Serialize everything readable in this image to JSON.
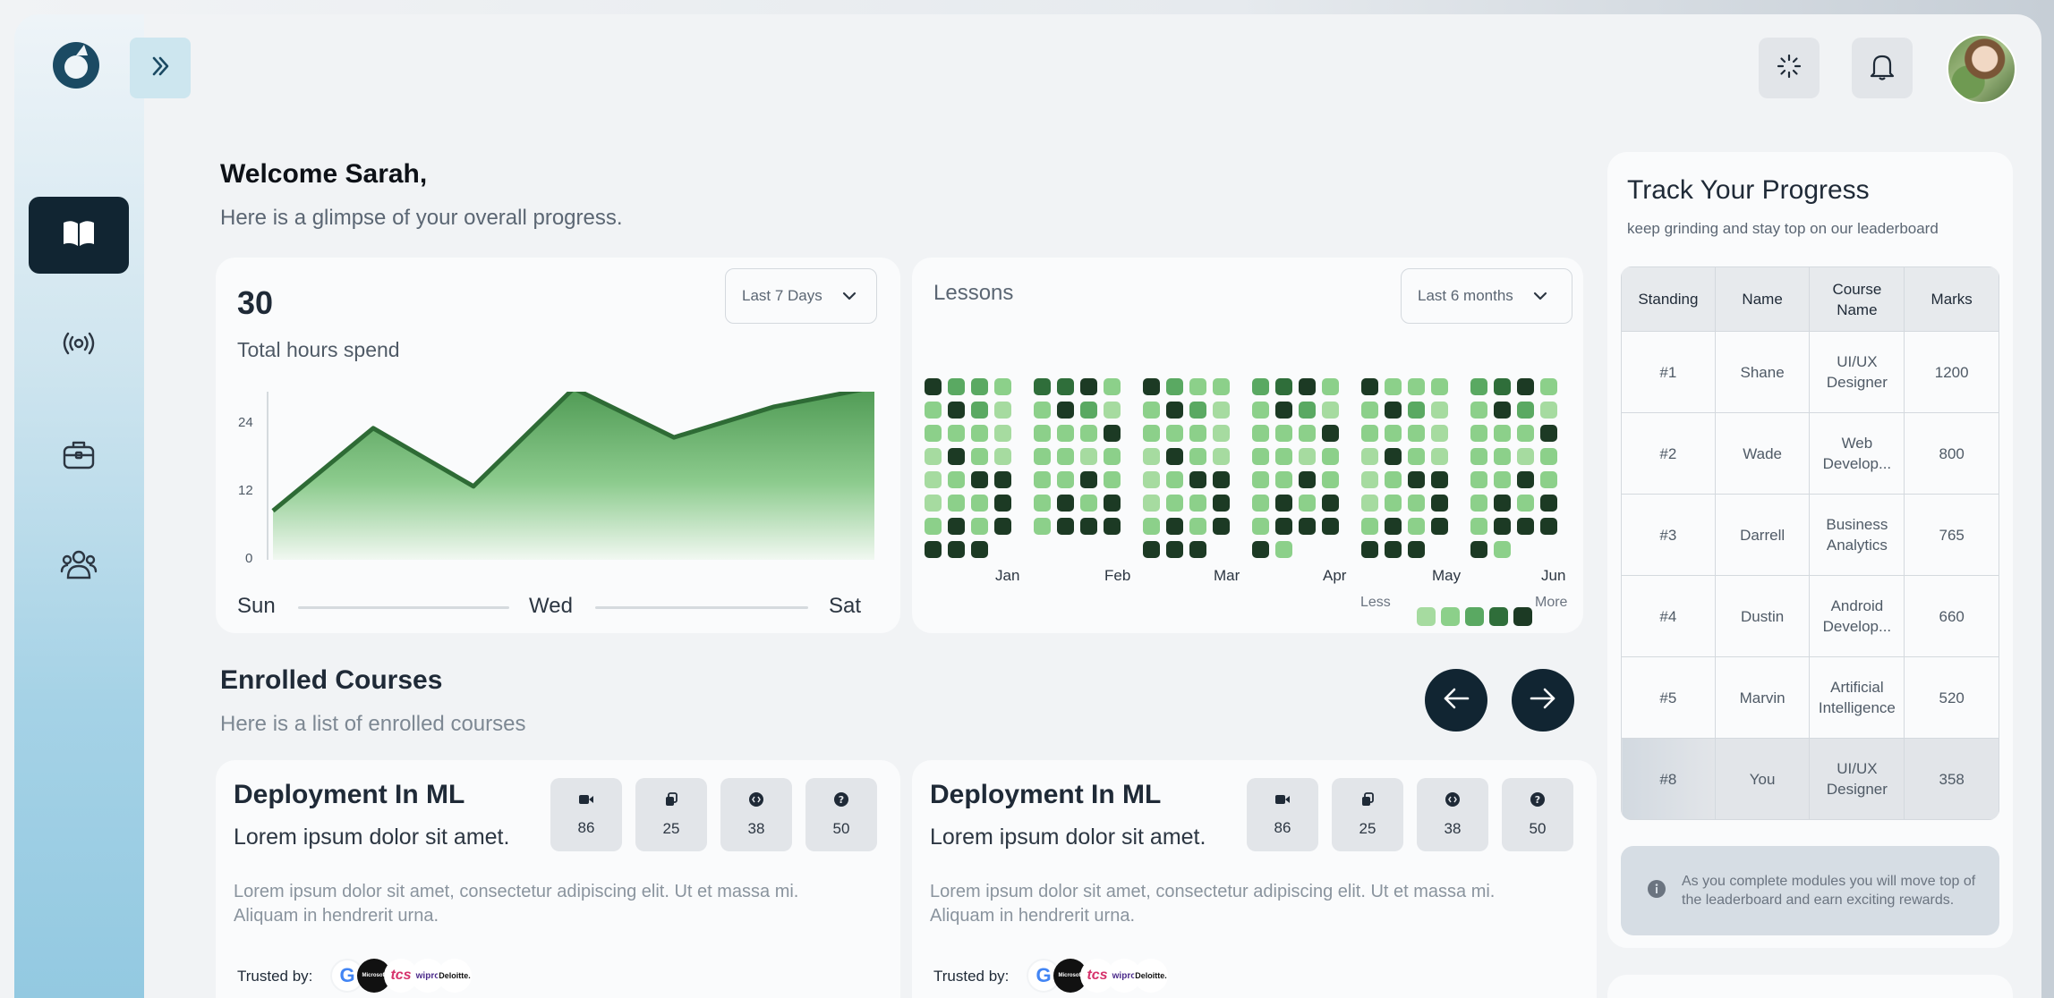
{
  "header": {
    "welcome": "Welcome Sarah,",
    "subtitle": "Here is a glimpse of your overall progress."
  },
  "sidebar": {
    "items": [
      {
        "icon": "book-icon",
        "active": true
      },
      {
        "icon": "broadcast-icon",
        "active": false
      },
      {
        "icon": "briefcase-icon",
        "active": false
      },
      {
        "icon": "users-icon",
        "active": false
      }
    ]
  },
  "hours_card": {
    "value": "30",
    "label": "Total hours spend",
    "range": "Last 7 Days",
    "y_ticks": [
      "24",
      "12",
      "0"
    ],
    "x_labels": [
      "Sun",
      "Wed",
      "Sat"
    ]
  },
  "chart_data": {
    "type": "area",
    "title": "",
    "xlabel": "",
    "ylabel": "",
    "x": [
      0,
      1,
      2,
      3,
      4,
      5,
      6
    ],
    "xlim": [
      0,
      6
    ],
    "ylim": [
      0,
      26
    ],
    "series": [
      {
        "values": [
          8,
          21.5,
          12,
          28,
          20,
          25,
          28.2
        ]
      }
    ],
    "x_tick_labels": [
      "Sun",
      "Wed",
      "Sat"
    ],
    "y_tick_labels": [
      "24",
      "12",
      "0"
    ],
    "color": "#2e6b35"
  },
  "lessons": {
    "title": "Lessons",
    "range": "Last 6 months",
    "months": [
      "Jan",
      "Feb",
      "Mar",
      "Apr",
      "May",
      "Jun"
    ],
    "legend_less": "Less",
    "legend_more": "More",
    "levels": [
      "#a6dba0",
      "#8cd08a",
      "#5aa962",
      "#2f6e3a",
      "#1c3a24"
    ],
    "grid": [
      [
        4,
        2,
        2,
        1,
        3,
        3,
        4,
        1,
        4,
        2,
        1,
        1,
        2,
        3,
        4,
        1,
        4,
        1,
        1,
        1,
        2,
        3,
        4,
        1
      ],
      [
        1,
        4,
        2,
        0,
        1,
        4,
        2,
        0,
        1,
        4,
        2,
        0,
        1,
        4,
        2,
        0,
        1,
        4,
        2,
        0,
        1,
        4,
        2,
        0
      ],
      [
        1,
        1,
        1,
        0,
        1,
        1,
        1,
        4,
        1,
        1,
        1,
        0,
        1,
        1,
        1,
        4,
        1,
        1,
        1,
        0,
        1,
        1,
        1,
        4
      ],
      [
        0,
        4,
        1,
        0,
        1,
        1,
        0,
        1,
        0,
        4,
        1,
        0,
        1,
        1,
        0,
        1,
        0,
        4,
        1,
        0,
        1,
        1,
        0,
        1
      ],
      [
        0,
        1,
        4,
        4,
        1,
        1,
        4,
        1,
        0,
        1,
        4,
        4,
        1,
        1,
        4,
        1,
        0,
        1,
        4,
        4,
        1,
        1,
        4,
        1
      ],
      [
        0,
        1,
        1,
        4,
        1,
        4,
        1,
        4,
        0,
        1,
        1,
        4,
        1,
        4,
        1,
        4,
        0,
        1,
        1,
        4,
        1,
        4,
        1,
        4
      ],
      [
        1,
        4,
        1,
        4,
        1,
        4,
        4,
        4,
        1,
        4,
        1,
        4,
        1,
        4,
        4,
        4,
        1,
        4,
        1,
        4,
        1,
        4,
        4,
        4
      ],
      [
        4,
        4,
        4,
        -1,
        -1,
        -1,
        -1,
        -1,
        4,
        4,
        4,
        -1,
        4,
        1,
        -1,
        -1,
        4,
        4,
        4,
        -1,
        4,
        1,
        -1,
        -1
      ]
    ]
  },
  "enrolled": {
    "title": "Enrolled Courses",
    "subtitle": "Here is a list of enrolled courses",
    "courses": [
      {
        "title": "Deployment In ML",
        "subtitle": "Lorem ipsum dolor sit amet.",
        "description": "Lorem ipsum dolor sit amet, consectetur adipiscing elit. Ut et massa mi. Aliquam in hendrerit urna.",
        "stats": [
          "86",
          "25",
          "38",
          "50"
        ],
        "trusted_label": "Trusted by:"
      },
      {
        "title": "Deployment In ML",
        "subtitle": "Lorem ipsum dolor sit amet.",
        "description": "Lorem ipsum dolor sit amet, consectetur adipiscing elit. Ut et massa mi. Aliquam in hendrerit urna.",
        "stats": [
          "86",
          "25",
          "38",
          "50"
        ],
        "trusted_label": "Trusted by:"
      }
    ],
    "brands": [
      "G",
      "Microsoft",
      "tcs",
      "wipro",
      "Deloitte."
    ]
  },
  "progress": {
    "title": "Track Your Progress",
    "subtitle": "keep grinding and stay top on our leaderboard",
    "columns": [
      "Standing",
      "Name",
      "Course Name",
      "Marks"
    ],
    "rows": [
      {
        "standing": "#1",
        "name": "Shane",
        "course": "UI/UX Designer",
        "marks": "1200"
      },
      {
        "standing": "#2",
        "name": "Wade",
        "course": "Web Develop...",
        "marks": "800"
      },
      {
        "standing": "#3",
        "name": "Darrell",
        "course": "Business Analytics",
        "marks": "765"
      },
      {
        "standing": "#4",
        "name": "Dustin",
        "course": "Android Develop...",
        "marks": "660"
      },
      {
        "standing": "#5",
        "name": "Marvin",
        "course": "Artificial Intelligence",
        "marks": "520"
      },
      {
        "standing": "#8",
        "name": "You",
        "course": "UI/UX Designer",
        "marks": "358"
      }
    ],
    "info": "As you complete modules you will move top of the leaderboard and earn exciting rewards."
  }
}
